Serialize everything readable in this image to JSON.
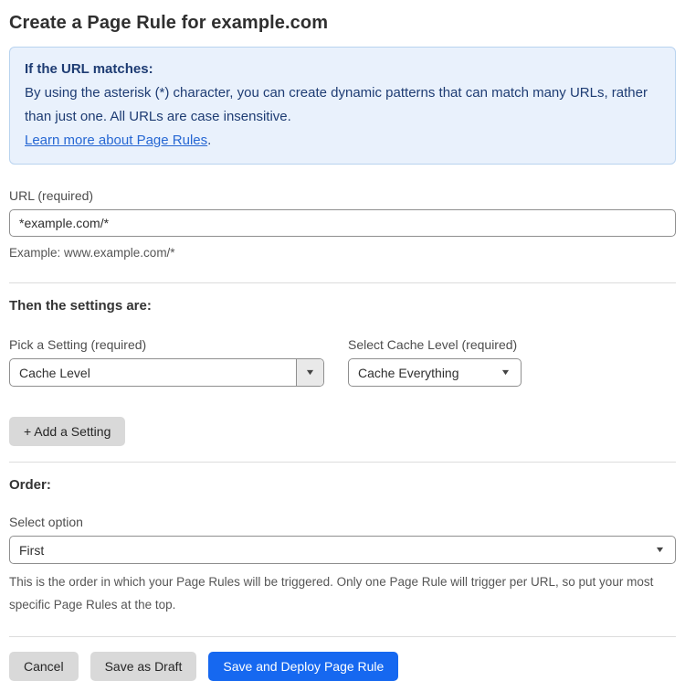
{
  "page": {
    "title": "Create a Page Rule for example.com"
  },
  "info_box": {
    "heading": "If the URL matches:",
    "body": "By using the asterisk (*) character, you can create dynamic patterns that can match many URLs, rather than just one. All URLs are case insensitive.",
    "link_label": "Learn more about Page Rules",
    "link_suffix": "."
  },
  "url_field": {
    "label": "URL (required)",
    "value": "*example.com/*",
    "helper": "Example: www.example.com/*"
  },
  "settings": {
    "heading": "Then the settings are:",
    "setting_picker": {
      "label": "Pick a Setting (required)",
      "value": "Cache Level"
    },
    "cache_level": {
      "label": "Select Cache Level (required)",
      "value": "Cache Everything"
    },
    "add_button_label": "+ Add a Setting"
  },
  "order": {
    "heading": "Order:",
    "select_label": "Select option",
    "value": "First",
    "helper": "This is the order in which your Page Rules will be triggered. Only one Page Rule will trigger per URL, so put your most specific Page Rules at the top."
  },
  "actions": {
    "cancel": "Cancel",
    "save_draft": "Save as Draft",
    "save_deploy": "Save and Deploy Page Rule"
  },
  "icons": {
    "dropdown_arrow": "▼"
  },
  "colors": {
    "accent_blue": "#1668f0",
    "info_bg": "#e9f1fc",
    "info_border": "#b9d3ef",
    "info_text": "#1e3c73",
    "link_blue": "#2667d3",
    "button_gray": "#d9d9d9"
  }
}
